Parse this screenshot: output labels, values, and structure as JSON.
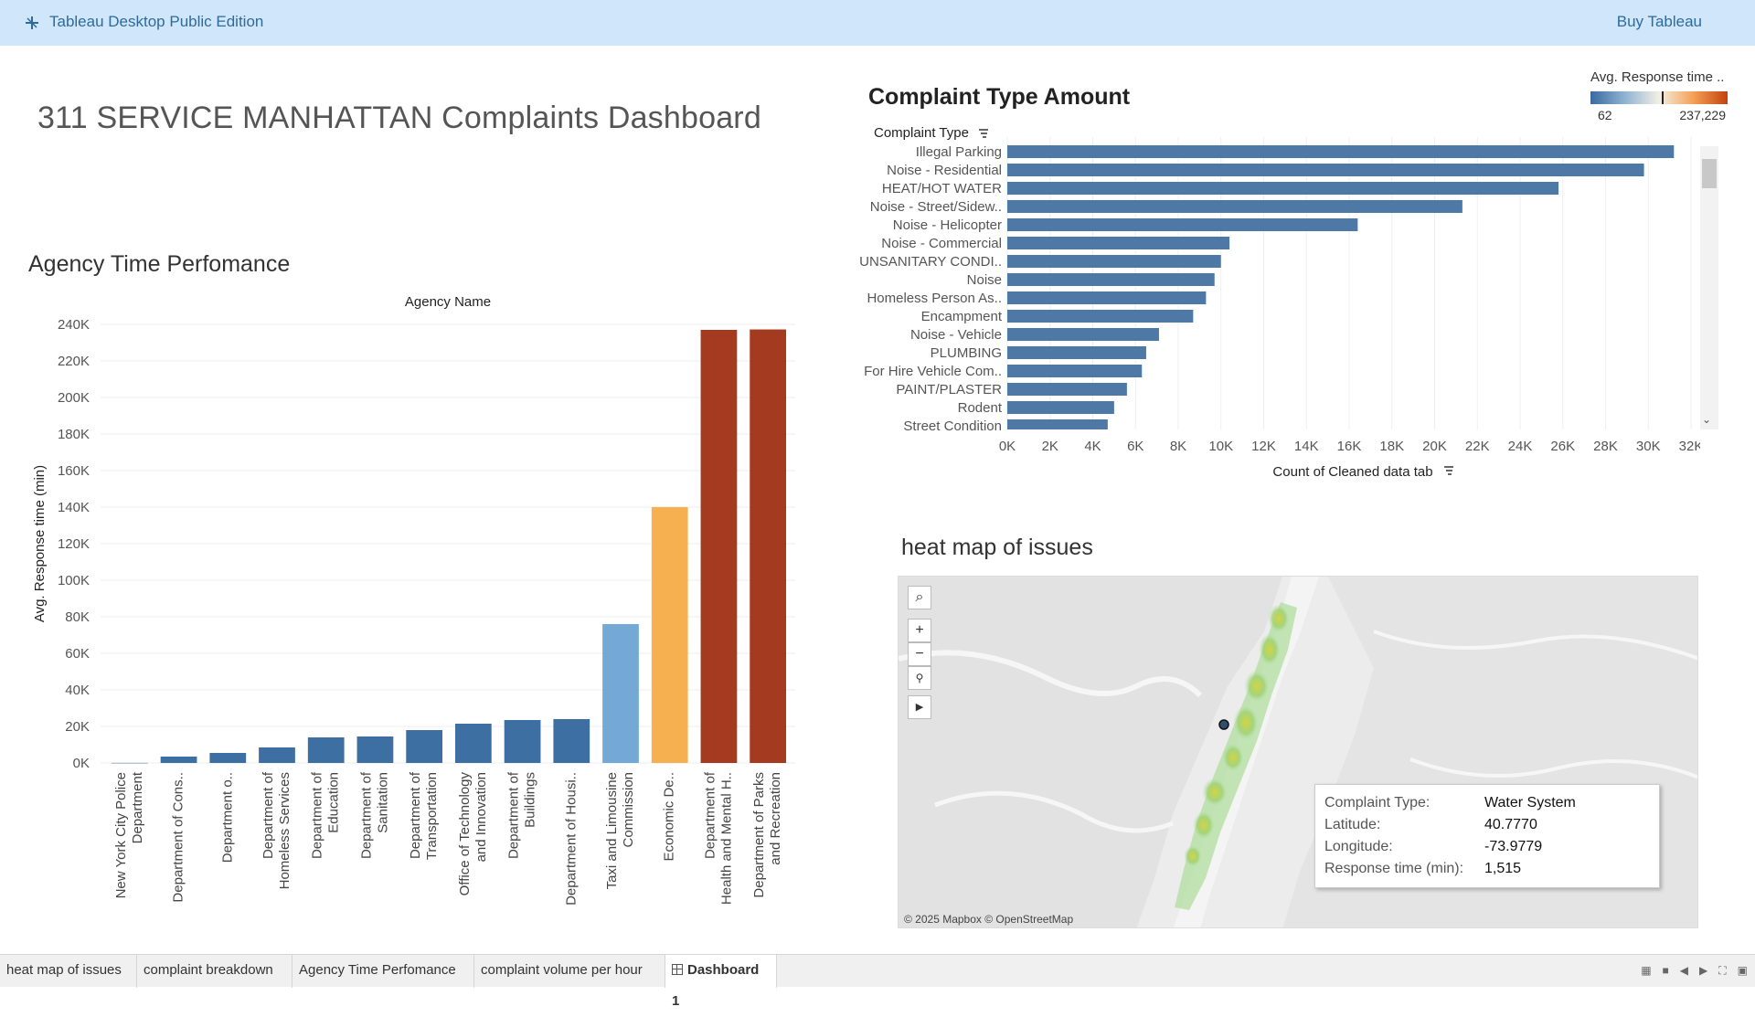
{
  "app": {
    "title": "Tableau Desktop Public Edition",
    "buy_label": "Buy Tableau"
  },
  "dashboard_title": "311 SERVICE MANHATTAN Complaints Dashboard",
  "agency": {
    "title": "Agency Time Perfomance",
    "header": "Agency Name",
    "ylabel": "Avg. Response time (min)"
  },
  "complaint": {
    "title": "Complaint Type Amount",
    "axis_header": "Complaint Type",
    "xlabel": "Count of Cleaned data tab"
  },
  "legend": {
    "title": "Avg. Response time ..",
    "min_label": "62",
    "max_label": "237,229"
  },
  "heatmap": {
    "title": "heat map of issues",
    "credit": "© 2025 Mapbox © OpenStreetMap"
  },
  "tooltip": {
    "rows": [
      {
        "key": "Complaint Type:",
        "value": "Water System"
      },
      {
        "key": "Latitude:",
        "value": "40.7770"
      },
      {
        "key": "Longitude:",
        "value": "-73.9779"
      },
      {
        "key": "Response time (min):",
        "value": "1,515"
      }
    ]
  },
  "tabs": [
    {
      "label": "heat map of issues"
    },
    {
      "label": "complaint breakdown"
    },
    {
      "label": "Agency Time Perfomance"
    },
    {
      "label": "complaint volume per hour"
    },
    {
      "label": "Dashboard 1"
    }
  ],
  "colors": {
    "topbar": "#cfe6fb",
    "bar_blue": "#3e6fa3",
    "bar_light_blue": "#74a9d6",
    "bar_orange": "#f7b050",
    "bar_red": "#a43b20",
    "complaint_bar": "#4e79a7"
  },
  "chart_data": [
    {
      "type": "bar",
      "title": "Agency Time Perfomance",
      "xlabel": "Agency Name",
      "ylabel": "Avg. Response time (min)",
      "ylim": [
        0,
        240000
      ],
      "yticks": [
        "0K",
        "20K",
        "40K",
        "60K",
        "80K",
        "100K",
        "120K",
        "140K",
        "160K",
        "180K",
        "200K",
        "220K",
        "240K"
      ],
      "categories": [
        [
          "New York City Police",
          "Department"
        ],
        [
          "Department of Cons.."
        ],
        [
          "Department o.."
        ],
        [
          "Department of",
          "Homeless Services"
        ],
        [
          "Department of",
          "Education"
        ],
        [
          "Department of",
          "Sanitation"
        ],
        [
          "Department of",
          "Transportation"
        ],
        [
          "Office of Technology",
          "and Innovation"
        ],
        [
          "Department of",
          "Buildings"
        ],
        [
          "Department of Housi.."
        ],
        [
          "Taxi and Limousine",
          "Commission"
        ],
        [
          "Economic De.."
        ],
        [
          "Department of",
          "Health and Mental H.."
        ],
        [
          "Department of Parks",
          "and Recreation"
        ]
      ],
      "values": [
        62,
        3500,
        5500,
        8500,
        14000,
        14500,
        18000,
        21500,
        23500,
        24000,
        76000,
        140000,
        237000,
        237229
      ],
      "colors": [
        "#3e6fa3",
        "#3e6fa3",
        "#3e6fa3",
        "#3e6fa3",
        "#3e6fa3",
        "#3e6fa3",
        "#3e6fa3",
        "#3e6fa3",
        "#3e6fa3",
        "#3e6fa3",
        "#74a9d6",
        "#f7b050",
        "#a43b20",
        "#a43b20"
      ],
      "grid": true
    },
    {
      "type": "bar",
      "orientation": "horizontal",
      "title": "Complaint Type Amount",
      "xlabel": "Count of Cleaned data tab",
      "ylabel": "Complaint Type",
      "xlim": [
        0,
        32000
      ],
      "xticks": [
        "0K",
        "2K",
        "4K",
        "6K",
        "8K",
        "10K",
        "12K",
        "14K",
        "16K",
        "18K",
        "20K",
        "22K",
        "24K",
        "26K",
        "28K",
        "30K",
        "32K"
      ],
      "categories": [
        "Illegal Parking",
        "Noise - Residential",
        "HEAT/HOT WATER",
        "Noise - Street/Sidew..",
        "Noise - Helicopter",
        "Noise - Commercial",
        "UNSANITARY CONDI..",
        "Noise",
        "Homeless Person As..",
        "Encampment",
        "Noise - Vehicle",
        "PLUMBING",
        "For Hire Vehicle Com..",
        "PAINT/PLASTER",
        "Rodent",
        "Street Condition"
      ],
      "values": [
        31200,
        29800,
        25800,
        21300,
        16400,
        10400,
        10000,
        9700,
        9300,
        8700,
        7100,
        6500,
        6300,
        5600,
        5000,
        4700
      ],
      "grid": true
    }
  ]
}
